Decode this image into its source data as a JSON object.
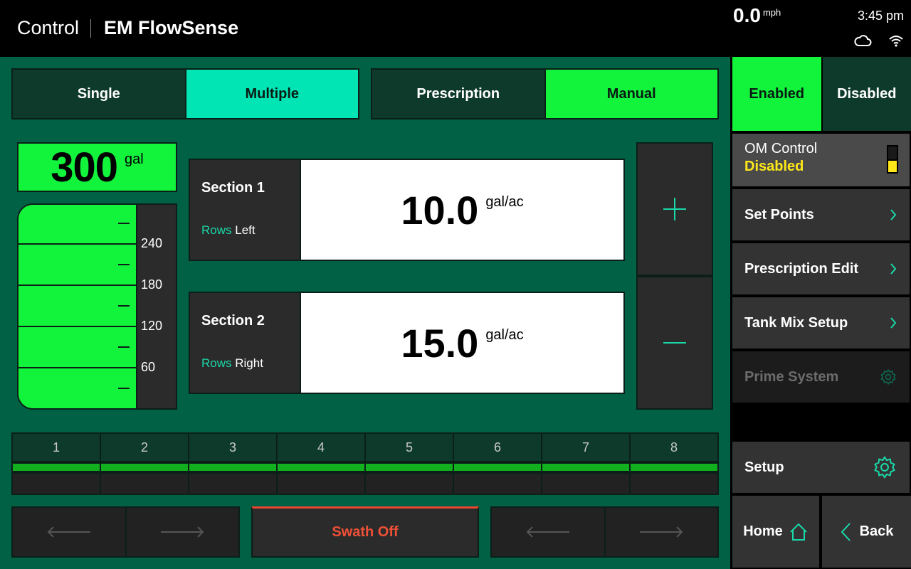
{
  "header": {
    "app": "Control",
    "screen": "EM FlowSense",
    "speed_value": "0.0",
    "speed_unit": "mph",
    "time": "3:45 pm",
    "status_icons": [
      "cloud-icon",
      "wifi-icon"
    ]
  },
  "mode_toggle": {
    "options": [
      "Single",
      "Multiple"
    ],
    "selected": "Multiple"
  },
  "rate_source_toggle": {
    "options": [
      "Prescription",
      "Manual"
    ],
    "selected": "Manual"
  },
  "tank": {
    "volume": "300",
    "unit": "gal",
    "fill_fraction": 1.0,
    "scale_labels": [
      "240",
      "180",
      "120",
      "60"
    ]
  },
  "sections": [
    {
      "name": "Section 1",
      "rows_key": "Rows",
      "rows_value": "Left",
      "rate": "10.0",
      "unit": "gal/ac"
    },
    {
      "name": "Section 2",
      "rows_key": "Rows",
      "rows_value": "Right",
      "rate": "15.0",
      "unit": "gal/ac"
    }
  ],
  "stepper": {
    "increase_icon": "plus-icon",
    "decrease_icon": "minus-icon"
  },
  "rows": [
    "1",
    "2",
    "3",
    "4",
    "5",
    "6",
    "7",
    "8"
  ],
  "bottom": {
    "swath_label": "Swath Off"
  },
  "sidebar": {
    "enable_toggle": {
      "options": [
        "Enabled",
        "Disabled"
      ],
      "selected": "Enabled"
    },
    "om_control": {
      "label": "OM Control",
      "status": "Disabled"
    },
    "menu": [
      {
        "label": "Set Points",
        "icon": "chevron-right-icon"
      },
      {
        "label": "Prescription Edit",
        "icon": "chevron-right-icon"
      },
      {
        "label": "Tank Mix Setup",
        "icon": "chevron-right-icon"
      },
      {
        "label": "Prime System",
        "icon": "gear-icon",
        "disabled": true
      }
    ],
    "setup_label": "Setup",
    "home_label": "Home",
    "back_label": "Back"
  },
  "colors": {
    "background_green": "#006145",
    "active_green": "#12f33c",
    "active_teal": "#00e5b3",
    "accent_teal": "#19d9a8",
    "warning_yellow": "#ffe81a",
    "swath_red": "#e8462f"
  }
}
